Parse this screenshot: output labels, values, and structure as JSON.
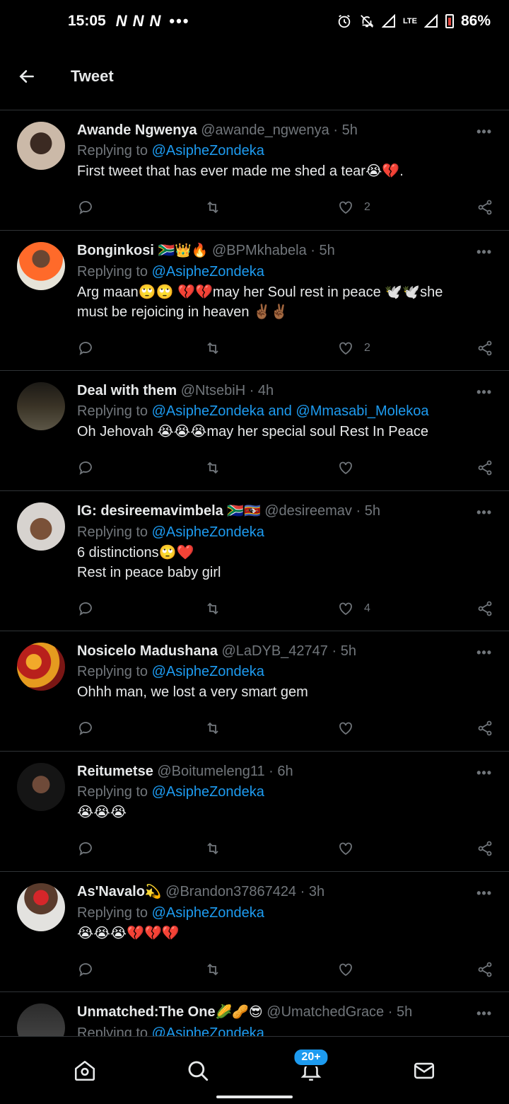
{
  "status_bar": {
    "time": "15:05",
    "network_icons": [
      "N",
      "N",
      "N"
    ],
    "more": "•••",
    "lte": "LTE",
    "battery": "86%"
  },
  "header": {
    "back_icon": "arrow-left-icon",
    "title": "Tweet"
  },
  "colors": {
    "background": "#000000",
    "text": "#e7e9ea",
    "muted": "#71767b",
    "accent": "#1d9bf0",
    "divider": "#2f3336"
  },
  "tweets": [
    {
      "name": "Awande Ngwenya",
      "name_emoji": "",
      "handle": "@awande_ngwenya",
      "time": "5h",
      "replying_prefix": "Replying to",
      "replying_to": "@AsipheZondeka",
      "lines": [
        "First tweet that has ever made me shed a tear😭💔."
      ],
      "likes": "2"
    },
    {
      "name": "Bonginkosi",
      "name_emoji": "🇿🇦👑🔥",
      "handle": "@BPMkhabela",
      "time": "5h",
      "replying_prefix": "Replying to",
      "replying_to": "@AsipheZondeka",
      "lines": [
        "Arg maan🙄🙄 💔💔may her Soul rest in peace 🕊️🕊️she",
        "must be rejoicing in heaven ✌🏾✌🏾"
      ],
      "likes": "2"
    },
    {
      "name": "Deal with them",
      "name_emoji": "",
      "handle": "@NtsebiH",
      "time": "4h",
      "replying_prefix": "Replying to",
      "replying_to": "@AsipheZondeka and @Mmasabi_Molekoa",
      "lines": [
        "Oh Jehovah 😭😭😭may her special soul Rest In Peace"
      ],
      "likes": ""
    },
    {
      "name": "IG: desireemavimbela",
      "name_emoji": "🇿🇦🇸🇿",
      "handle": "@desireemav",
      "time": "5h",
      "replying_prefix": "Replying to",
      "replying_to": "@AsipheZondeka",
      "lines": [
        "6 distinctions🙄❤️",
        "Rest in peace baby girl"
      ],
      "likes": "4"
    },
    {
      "name": "Nosicelo Madushana",
      "name_emoji": "",
      "handle": "@LaDYB_42747",
      "time": "5h",
      "replying_prefix": "Replying to",
      "replying_to": "@AsipheZondeka",
      "lines": [
        "Ohhh man, we lost a very smart gem"
      ],
      "likes": ""
    },
    {
      "name": "Reitumetse",
      "name_emoji": "",
      "handle": "@Boitumeleng11",
      "time": "6h",
      "replying_prefix": "Replying to",
      "replying_to": "@AsipheZondeka",
      "lines": [
        "😭😭😭"
      ],
      "likes": ""
    },
    {
      "name": "As'Navalo",
      "name_emoji": "💫",
      "handle": "@Brandon37867424",
      "time": "3h",
      "replying_prefix": "Replying to",
      "replying_to": "@AsipheZondeka",
      "lines": [
        "😭😭😭💔💔💔"
      ],
      "likes": ""
    },
    {
      "name": "Unmatched:The One",
      "name_emoji": "🌽🥜😎",
      "handle": "@UmatchedGrace",
      "time": "5h",
      "replying_prefix": "Replying to",
      "replying_to": "@AsipheZondeka",
      "lines": [],
      "likes": ""
    }
  ],
  "bottom_nav": {
    "home_icon": "home-icon",
    "search_icon": "search-icon",
    "notifications_icon": "bell-icon",
    "notifications_badge": "20+",
    "messages_icon": "mail-icon"
  }
}
